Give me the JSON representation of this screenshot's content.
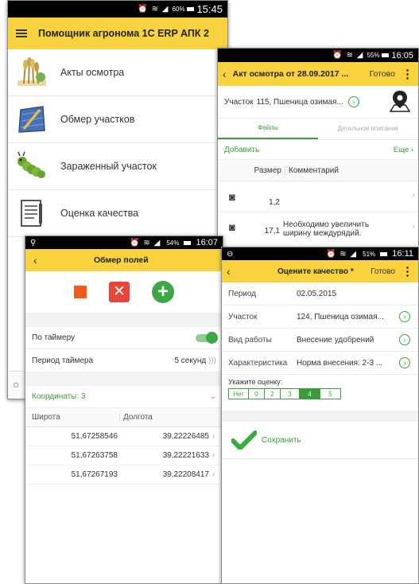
{
  "screen_main": {
    "status_time": "15:45",
    "battery": "60%",
    "app_title": "Помощник агронома 1С ERP АПК 2",
    "menu": [
      {
        "label": "Акты осмотра",
        "icon": "wheat-icon"
      },
      {
        "label": "Обмер участков",
        "icon": "field-measure-icon"
      },
      {
        "label": "Зараженный участок",
        "icon": "caterpillar-icon"
      },
      {
        "label": "Оценка качества",
        "icon": "document-icon"
      }
    ]
  },
  "screen_act": {
    "status_time": "16:05",
    "battery": "55%",
    "title": "Акт осмотра от 28.09.2017 ...",
    "ready": "Готово",
    "plot_label": "Участок",
    "plot_value": "115, Пшеница озимая...",
    "tabs": [
      "Файлы",
      "Детальное описание"
    ],
    "add": "Добавить",
    "more": "Еще",
    "col_size": "Размер",
    "col_comment": "Комментарий",
    "files": [
      {
        "size": "1,2",
        "comment": ""
      },
      {
        "size": "17,1",
        "comment": "Необходимо увеличить ширину междурядий."
      }
    ]
  },
  "screen_measure": {
    "status_time": "16:07",
    "battery": "54%",
    "title": "Обмер полей",
    "timer_label": "По таймеру",
    "timer_on": true,
    "period_label": "Период таймера",
    "period_value": "5 секунд",
    "coords_label": "Координаты: 3",
    "col_lat": "Широта",
    "col_lon": "Долгота",
    "coords": [
      {
        "lat": "51,67258546",
        "lon": "39,22226485"
      },
      {
        "lat": "51,67263758",
        "lon": "39,22221633"
      },
      {
        "lat": "51,67267193",
        "lon": "39,22208417"
      }
    ]
  },
  "screen_quality": {
    "status_time": "16:11",
    "battery": "51%",
    "title": "Оцените качество *",
    "ready": "Готово",
    "fields": [
      {
        "label": "Период",
        "value": "02.05.2015",
        "chevron": false
      },
      {
        "label": "Участок",
        "value": "124, Пшеница озимая...",
        "chevron": true
      },
      {
        "label": "Вид работы",
        "value": "Внесение удобрений",
        "chevron": true
      },
      {
        "label": "Характеристика",
        "value": "Норма внесения: 2-3 ...",
        "chevron": true
      }
    ],
    "rating_label": "Укажите оценку:",
    "rating_options": [
      "Нет",
      "0",
      "2",
      "3",
      "4",
      "5"
    ],
    "rating_selected": "4",
    "save": "Сохранить"
  },
  "colors": {
    "appbar": "#f9d33f",
    "green": "#3a9c3a",
    "red": "#e8443a",
    "orange": "#f35a1c"
  }
}
